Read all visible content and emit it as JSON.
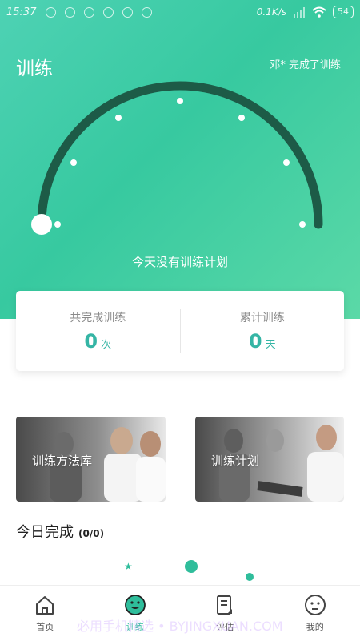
{
  "status_bar": {
    "time": "15:37",
    "speed": "0.1K/s",
    "battery": "54"
  },
  "header": {
    "title": "训练",
    "friend_note": "邓* 完成了训练"
  },
  "gauge": {
    "progress": 0,
    "plan_text": "今天没有训练计划"
  },
  "stats": {
    "completed_label": "共完成训练",
    "completed_value": "0",
    "completed_unit": "次",
    "total_label": "累计训练",
    "total_value": "0",
    "total_unit": "天"
  },
  "features": [
    {
      "label": "训练方法库"
    },
    {
      "label": "训练计划"
    }
  ],
  "today": {
    "title": "今日完成",
    "count": "(0/0)"
  },
  "tabs": [
    {
      "label": "首页",
      "icon": "home-icon"
    },
    {
      "label": "训练",
      "icon": "smile-icon"
    },
    {
      "label": "评估",
      "icon": "document-icon"
    },
    {
      "label": "我的",
      "icon": "face-icon"
    }
  ],
  "watermark": "必用手机精选 • BYJINGXUAN.COM",
  "colors": {
    "accent": "#2fbd9b",
    "gauge_arc": "#1d5b47",
    "stat_value": "#35b5a5"
  }
}
